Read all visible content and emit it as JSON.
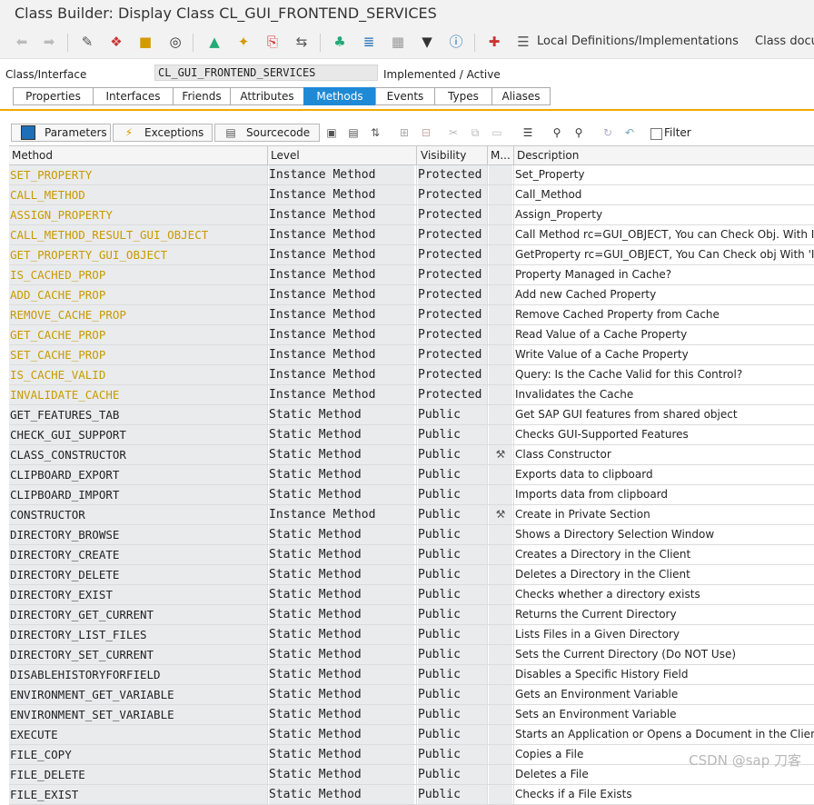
{
  "window": {
    "title": "Class Builder: Display Class CL_GUI_FRONTEND_SERVICES"
  },
  "toolbar": {
    "local_defs_label": "Local Definitions/Implementations",
    "class_doc_label": "Class docu"
  },
  "class_interface": {
    "label": "Class/Interface",
    "value": "CL_GUI_FRONTEND_SERVICES",
    "status": "Implemented / Active"
  },
  "tabs": [
    "Properties",
    "Interfaces",
    "Friends",
    "Attributes",
    "Methods",
    "Events",
    "Types",
    "Aliases"
  ],
  "active_tab": "Methods",
  "subtoolbar": {
    "parameters_label": "Parameters",
    "exceptions_label": "Exceptions",
    "sourcecode_label": "Sourcecode",
    "filter_label": "Filter"
  },
  "table": {
    "headers": {
      "method": "Method",
      "level": "Level",
      "visibility": "Visibility",
      "modeled": "M...",
      "description": "Description"
    },
    "rows": [
      {
        "method": "SET_PROPERTY",
        "level": "Instance Method",
        "visibility": "Protected",
        "mark": "",
        "description": "Set_Property",
        "highlight": true
      },
      {
        "method": "CALL_METHOD",
        "level": "Instance Method",
        "visibility": "Protected",
        "mark": "",
        "description": "Call_Method",
        "highlight": true
      },
      {
        "method": "ASSIGN_PROPERTY",
        "level": "Instance Method",
        "visibility": "Protected",
        "mark": "",
        "description": "Assign_Property",
        "highlight": true
      },
      {
        "method": "CALL_METHOD_RESULT_GUI_OBJECT",
        "level": "Instance Method",
        "visibility": "Protected",
        "mark": "",
        "description": "Call Method rc=GUI_OBJECT, You can Check Obj. With IS_V",
        "highlight": true
      },
      {
        "method": "GET_PROPERTY_GUI_OBJECT",
        "level": "Instance Method",
        "visibility": "Protected",
        "mark": "",
        "description": "GetProperty rc=GUI_OBJECT, You Can Check obj With 'IS_V",
        "highlight": true
      },
      {
        "method": "IS_CACHED_PROP",
        "level": "Instance Method",
        "visibility": "Protected",
        "mark": "",
        "description": "Property Managed in Cache?",
        "highlight": true
      },
      {
        "method": "ADD_CACHE_PROP",
        "level": "Instance Method",
        "visibility": "Protected",
        "mark": "",
        "description": "Add new Cached Property",
        "highlight": true
      },
      {
        "method": "REMOVE_CACHE_PROP",
        "level": "Instance Method",
        "visibility": "Protected",
        "mark": "",
        "description": "Remove Cached Property from Cache",
        "highlight": true
      },
      {
        "method": "GET_CACHE_PROP",
        "level": "Instance Method",
        "visibility": "Protected",
        "mark": "",
        "description": "Read Value of a Cache Property",
        "highlight": true
      },
      {
        "method": "SET_CACHE_PROP",
        "level": "Instance Method",
        "visibility": "Protected",
        "mark": "",
        "description": "Write Value of a Cache Property",
        "highlight": true
      },
      {
        "method": "IS_CACHE_VALID",
        "level": "Instance Method",
        "visibility": "Protected",
        "mark": "",
        "description": "Query: Is the Cache Valid for this Control?",
        "highlight": true
      },
      {
        "method": "INVALIDATE_CACHE",
        "level": "Instance Method",
        "visibility": "Protected",
        "mark": "",
        "description": "Invalidates the Cache",
        "highlight": true
      },
      {
        "method": "GET_FEATURES_TAB",
        "level": "Static Method",
        "visibility": "Public",
        "mark": "",
        "description": "Get SAP GUI features from shared object",
        "highlight": false
      },
      {
        "method": "CHECK_GUI_SUPPORT",
        "level": "Static Method",
        "visibility": "Public",
        "mark": "",
        "description": "Checks GUI-Supported Features",
        "highlight": false
      },
      {
        "method": "CLASS_CONSTRUCTOR",
        "level": "Static Method",
        "visibility": "Public",
        "mark": "ctor",
        "description": "Class Constructor",
        "highlight": false
      },
      {
        "method": "CLIPBOARD_EXPORT",
        "level": "Static Method",
        "visibility": "Public",
        "mark": "",
        "description": "Exports data to clipboard",
        "highlight": false
      },
      {
        "method": "CLIPBOARD_IMPORT",
        "level": "Static Method",
        "visibility": "Public",
        "mark": "",
        "description": "Imports data from clipboard",
        "highlight": false
      },
      {
        "method": "CONSTRUCTOR",
        "level": "Instance Method",
        "visibility": "Public",
        "mark": "ctor",
        "description": "Create in Private Section",
        "highlight": false
      },
      {
        "method": "DIRECTORY_BROWSE",
        "level": "Static Method",
        "visibility": "Public",
        "mark": "",
        "description": "Shows a Directory Selection Window",
        "highlight": false
      },
      {
        "method": "DIRECTORY_CREATE",
        "level": "Static Method",
        "visibility": "Public",
        "mark": "",
        "description": "Creates a Directory in the Client",
        "highlight": false
      },
      {
        "method": "DIRECTORY_DELETE",
        "level": "Static Method",
        "visibility": "Public",
        "mark": "",
        "description": "Deletes a Directory in the Client",
        "highlight": false
      },
      {
        "method": "DIRECTORY_EXIST",
        "level": "Static Method",
        "visibility": "Public",
        "mark": "",
        "description": "Checks whether a directory exists",
        "highlight": false
      },
      {
        "method": "DIRECTORY_GET_CURRENT",
        "level": "Static Method",
        "visibility": "Public",
        "mark": "",
        "description": "Returns the Current Directory",
        "highlight": false
      },
      {
        "method": "DIRECTORY_LIST_FILES",
        "level": "Static Method",
        "visibility": "Public",
        "mark": "",
        "description": "Lists Files in a Given Directory",
        "highlight": false
      },
      {
        "method": "DIRECTORY_SET_CURRENT",
        "level": "Static Method",
        "visibility": "Public",
        "mark": "",
        "description": "Sets the Current Directory (Do NOT Use)",
        "highlight": false
      },
      {
        "method": "DISABLEHISTORYFORFIELD",
        "level": "Static Method",
        "visibility": "Public",
        "mark": "",
        "description": "Disables a Specific History Field",
        "highlight": false
      },
      {
        "method": "ENVIRONMENT_GET_VARIABLE",
        "level": "Static Method",
        "visibility": "Public",
        "mark": "",
        "description": "Gets an Environment Variable",
        "highlight": false
      },
      {
        "method": "ENVIRONMENT_SET_VARIABLE",
        "level": "Static Method",
        "visibility": "Public",
        "mark": "",
        "description": "Sets an Environment Variable",
        "highlight": false
      },
      {
        "method": "EXECUTE",
        "level": "Static Method",
        "visibility": "Public",
        "mark": "",
        "description": "Starts an Application or Opens a Document in the Client",
        "highlight": false
      },
      {
        "method": "FILE_COPY",
        "level": "Static Method",
        "visibility": "Public",
        "mark": "",
        "description": "Copies a File",
        "highlight": false
      },
      {
        "method": "FILE_DELETE",
        "level": "Static Method",
        "visibility": "Public",
        "mark": "",
        "description": "Deletes a File",
        "highlight": false
      },
      {
        "method": "FILE_EXIST",
        "level": "Static Method",
        "visibility": "Public",
        "mark": "",
        "description": "Checks if a File Exists",
        "highlight": false
      }
    ]
  },
  "watermark": "CSDN @sap 刀客",
  "colors": {
    "accent": "#1e8ad6",
    "highlight_text": "#c99a00",
    "separator": "#f0ab00"
  }
}
